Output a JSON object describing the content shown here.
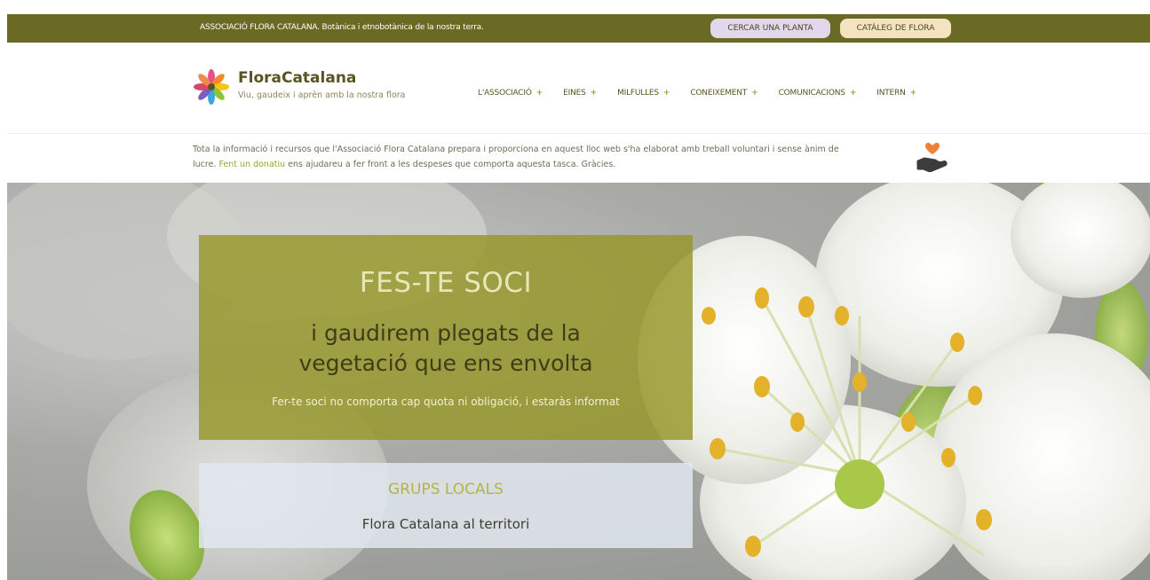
{
  "topbar": {
    "text": "ASSOCIACIÓ FLORA CATALANA. Botànica i etnobotànica de la nostra terra.",
    "buttons": [
      "CERCAR UNA PLANTA",
      "CATÀLEG DE FLORA"
    ],
    "bg_color": "#6b6a24"
  },
  "brand": {
    "name": "FloraCatalana",
    "tagline": "Viu, gaudeix i aprèn amb la nostra flora",
    "logo_icon": "multicolor-flower-icon"
  },
  "nav": {
    "items": [
      "L'ASSOCIACIÓ",
      "EINES",
      "MILFULLES",
      "CONEIXEMENT",
      "COMUNICACIONS",
      "INTERN"
    ],
    "expand_symbol": "+"
  },
  "notice": {
    "text_before": "Tota la informació i recursos que l'Associació Flora Catalana prepara i proporciona en aquest lloc web s'ha elaborat amb treball voluntari i sense ànim de lucre. ",
    "link": "Fent un donatiu",
    "text_after": " ens ajudareu a fer front a les despeses que comporta aquesta tasca. Gràcies.",
    "icon": "donate-heart-hand-icon"
  },
  "hero": {
    "card1": {
      "title": "FES-TE SOCI",
      "line1": "i gaudirem plegats de la",
      "line2": "vegetació que ens envolta",
      "subtitle": "Fer-te soci no comporta cap quota ni obligació, i estaràs informat"
    },
    "card2": {
      "title": "GRUPS LOCALS",
      "subtitle": "Flora Catalana al territori"
    }
  },
  "colors": {
    "accent_green": "#8fa82a",
    "olive": "#6b6a24",
    "lilac": "#e2d8ee",
    "peach": "#f4e3c0"
  }
}
